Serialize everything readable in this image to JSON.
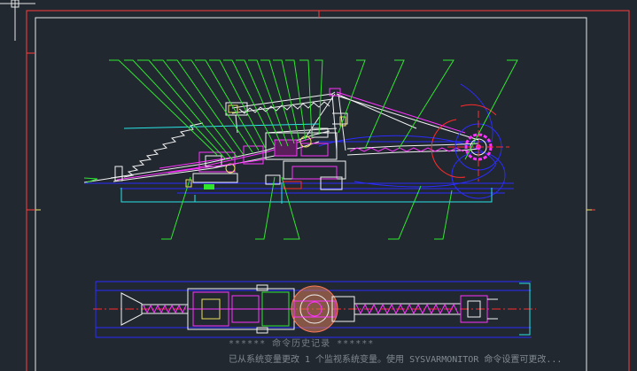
{
  "app": {
    "type": "CAD model space",
    "background": "#212830"
  },
  "colors": {
    "outer_frame": "#ff3b3b",
    "inner_frame": "#e8e8e8",
    "leaders": "#2ee82e",
    "structure": "#ff33ff",
    "outline": "#f2f2f2",
    "centerline_blue": "#2c2cff",
    "cyan": "#29e6e6",
    "yellow": "#f0e05a",
    "red": "#ff2b2b"
  },
  "icons": {
    "crosshair": "cursor-crosshair-icon"
  },
  "command_line": {
    "history": "****** 命令历史记录 ******",
    "prompt": "已从系统变量更改 1 个监视系统变量。使用 SYSVARMONITOR 命令设置可更改..."
  }
}
